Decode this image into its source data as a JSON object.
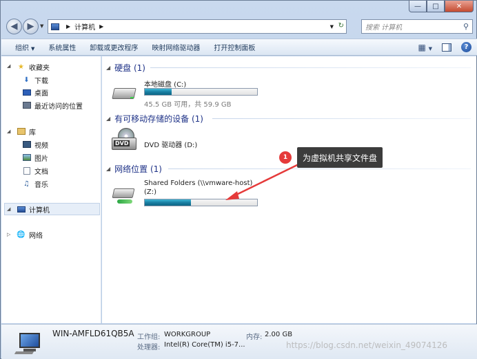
{
  "address": {
    "crumb": "计算机",
    "search_placeholder": "搜索 计算机"
  },
  "toolbar": {
    "organize": "组织",
    "system_properties": "系统属性",
    "uninstall": "卸载或更改程序",
    "map_drive": "映射网络驱动器",
    "control_panel": "打开控制面板"
  },
  "sidebar": {
    "favorites": "收藏夹",
    "downloads": "下载",
    "desktop": "桌面",
    "recent": "最近访问的位置",
    "libraries": "库",
    "videos": "视频",
    "pictures": "图片",
    "documents": "文档",
    "music": "音乐",
    "computer": "计算机",
    "network": "网络"
  },
  "groups": {
    "hdd": "硬盘 (1)",
    "removable": "有可移动存储的设备 (1)",
    "network": "网络位置 (1)"
  },
  "drives": {
    "c_name": "本地磁盘 (C:)",
    "c_info": "45.5 GB 可用，共 59.9 GB",
    "c_used_fraction": 0.24,
    "dvd_name": "DVD 驱动器 (D:)",
    "dvd_label": "DVD",
    "z_name_line1": "Shared Folders (\\\\vmware-host)",
    "z_name_line2": "(Z:)",
    "z_used_fraction": 0.41
  },
  "annotation": {
    "badge": "1",
    "text": "为虚拟机共享文件盘",
    "color": "#e53a3a"
  },
  "details": {
    "computer_name": "WIN-AMFLD61QB5A",
    "workgroup_label": "工作组:",
    "workgroup_value": "WORKGROUP",
    "memory_label": "内存:",
    "memory_value": "2.00 GB",
    "cpu_label": "处理器:",
    "cpu_value": "Intel(R) Core(TM) i5-7..."
  },
  "watermark": "https://blog.csdn.net/weixin_49074126"
}
